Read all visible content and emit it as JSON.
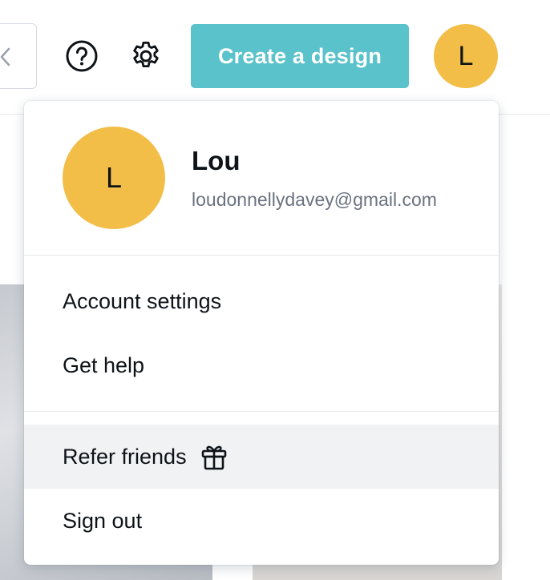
{
  "header": {
    "help_icon": "question-circle-icon",
    "settings_icon": "gear-icon",
    "create_button_label": "Create a design",
    "avatar_initial": "L"
  },
  "account_menu": {
    "avatar_initial": "L",
    "user_name": "Lou",
    "user_email": "loudonnellydavey@gmail.com",
    "items": [
      {
        "label": "Account settings"
      },
      {
        "label": "Get help"
      },
      {
        "label": "Refer friends",
        "icon": "gift-icon",
        "highlighted": true
      },
      {
        "label": "Sign out"
      }
    ]
  },
  "colors": {
    "accent": "#5ac2cb",
    "avatar": "#f2be48",
    "hover": "#f1f2f4"
  }
}
